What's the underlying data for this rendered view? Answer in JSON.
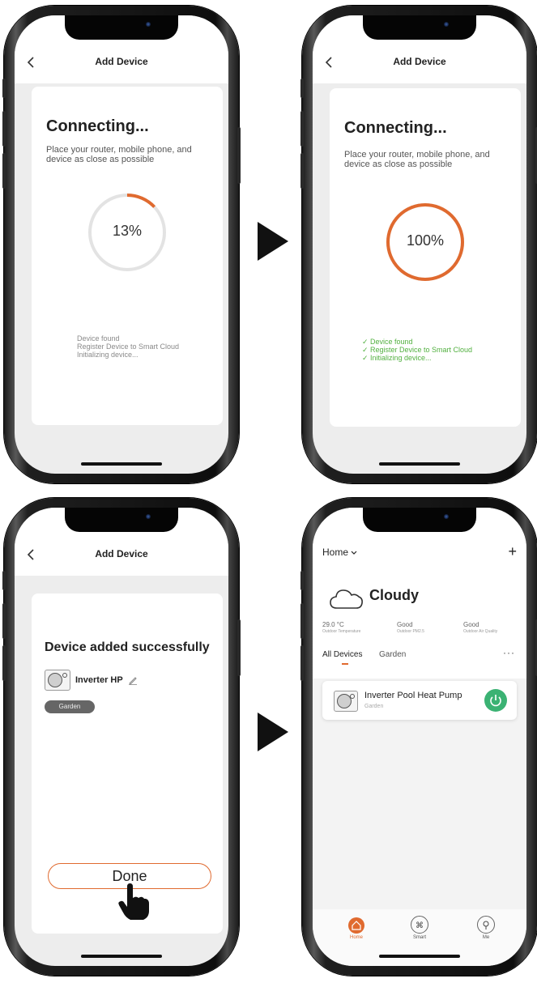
{
  "panel1": {
    "nav_title": "Add Device",
    "heading": "Connecting...",
    "subtext": "Place your router, mobile phone, and device as close as possible",
    "progress_label": "13%",
    "progress": 0.13,
    "steps": [
      "Device found",
      "Register Device to Smart Cloud",
      "Initializing device..."
    ]
  },
  "panel2": {
    "nav_title": "Add Device",
    "heading": "Connecting...",
    "subtext": "Place your router, mobile phone, and device as close as possible",
    "progress_label": "100%",
    "progress": 1.0,
    "check_icon": "✓",
    "steps": [
      "Device found",
      "Register Device to Smart Cloud",
      "Initializing device..."
    ]
  },
  "panel3": {
    "nav_title": "Add Device",
    "heading": "Device added successfully",
    "device_name": "Inverter HP",
    "room": "Garden",
    "done_label": "Done"
  },
  "panel4": {
    "home_label": "Home",
    "weather": "Cloudy",
    "stats": [
      {
        "value": "29.0 °C",
        "label": "Outdoor Temperature"
      },
      {
        "value": "Good",
        "label": "Outdoor PM2.5"
      },
      {
        "value": "Good",
        "label": "Outdoor Air Quality"
      }
    ],
    "tabs": [
      "All Devices",
      "Garden"
    ],
    "device_name": "Inverter Pool Heat Pump",
    "device_room": "Garden",
    "tabbar": [
      "Home",
      "Smart",
      "Me"
    ]
  },
  "colors": {
    "accent": "#e06a2f",
    "success": "#52b040",
    "power": "#3bb273"
  }
}
